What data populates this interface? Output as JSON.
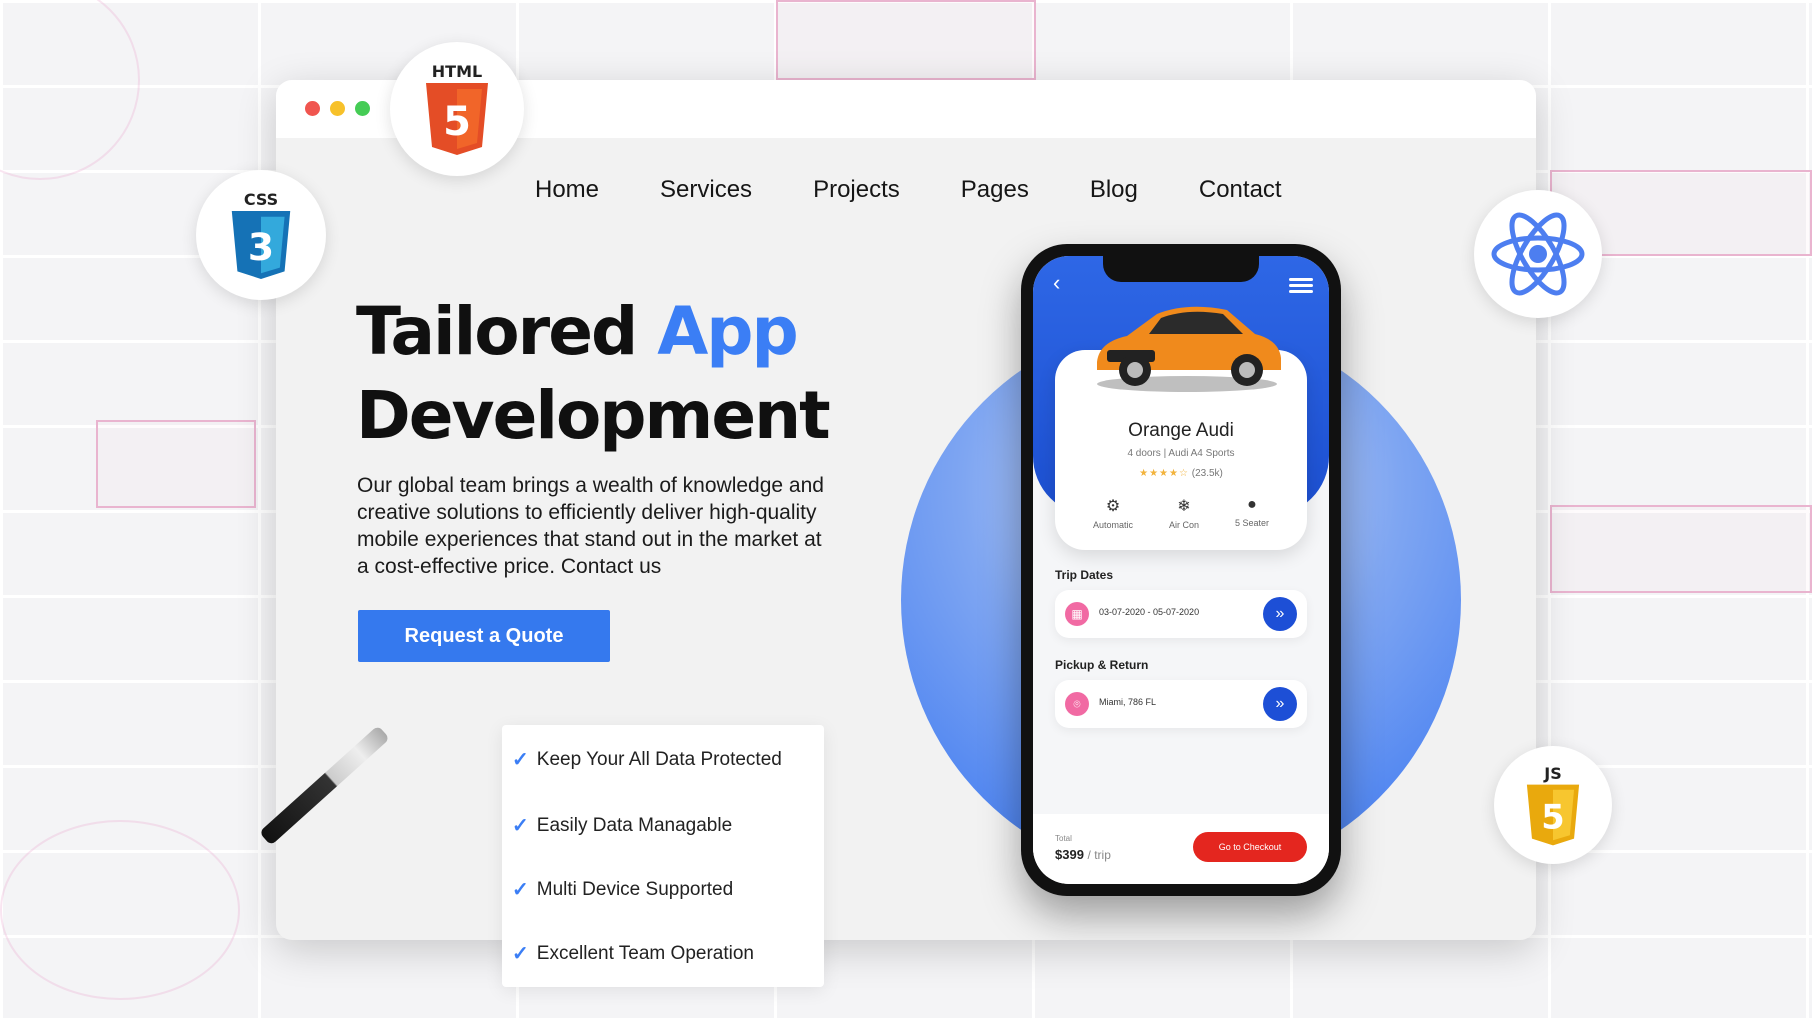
{
  "window": {
    "nav": [
      "Home",
      "Services",
      "Projects",
      "Pages",
      "Blog",
      "Contact"
    ]
  },
  "hero": {
    "title_part1": "Tailored",
    "title_accent": "App",
    "title_part2": "Development",
    "description": "Our global team brings a wealth of knowledge and creative solutions to efficiently deliver high-quality mobile experiences that stand out in the market at a cost-effective price. Contact us",
    "cta_label": "Request a Quote",
    "accent_color": "#3b7ef5"
  },
  "features": [
    "Keep Your All Data Protected",
    "Easily Data Managable",
    "Multi Device Supported",
    "Excellent Team Operation"
  ],
  "badges": {
    "html": "HTML",
    "css": "CSS",
    "js": "JS"
  },
  "phone": {
    "car_name": "Orange Audi",
    "car_sub": "4 doors  |  Audi A4 Sports",
    "rating_stars": "★★★★☆",
    "rating_count": "(23.5k)",
    "features": [
      {
        "icon": "gear-icon",
        "glyph": "⚙",
        "label": "Automatic"
      },
      {
        "icon": "snowflake-icon",
        "glyph": "❄",
        "label": "Air Con"
      },
      {
        "icon": "person-icon",
        "glyph": "●",
        "label": "5 Seater"
      }
    ],
    "trip_dates_label": "Trip Dates",
    "trip_dates_value": "03-07-2020 - 05-07-2020",
    "pickup_label": "Pickup & Return",
    "pickup_value": "Miami, 786 FL",
    "total_label": "Total",
    "total_value": "$399",
    "total_per": "/ trip",
    "checkout_label": "Go to Checkout",
    "car_color": "#f08a1c"
  }
}
